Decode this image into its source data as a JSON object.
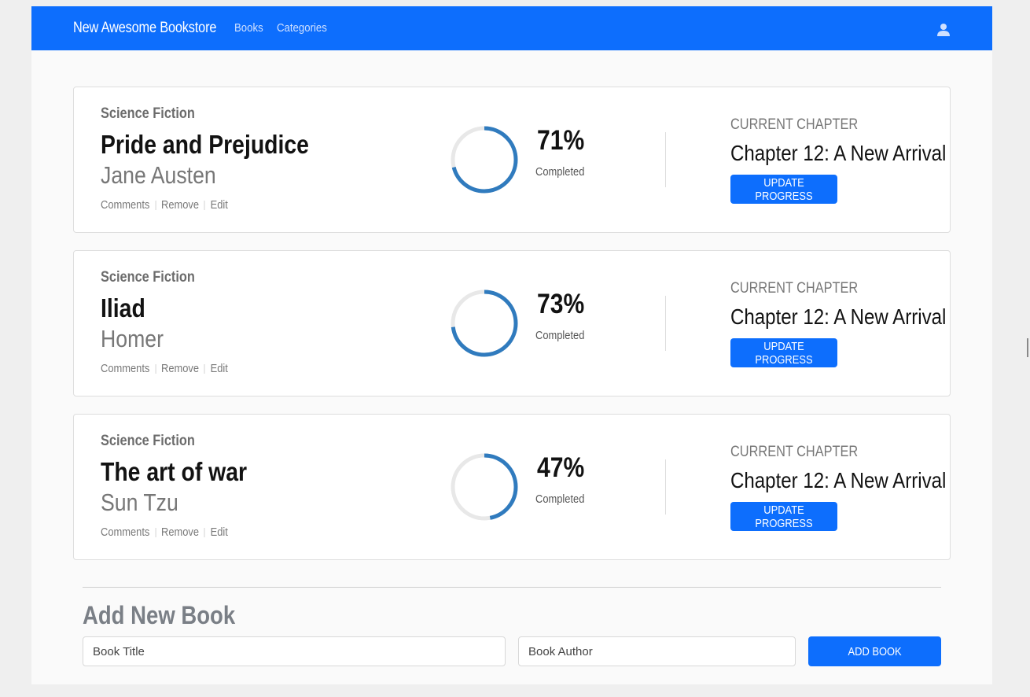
{
  "navbar": {
    "brand": "New Awesome Bookstore",
    "links": [
      {
        "label": "Books"
      },
      {
        "label": "Categories"
      }
    ],
    "user_icon": "user-icon"
  },
  "books": [
    {
      "genre": "Science Fiction",
      "title": "Pride and Prejudice",
      "author": "Jane Austen",
      "actions": [
        "Comments",
        "Remove",
        "Edit"
      ],
      "progress": 71,
      "progress_text": "71%",
      "completed_label": "Completed",
      "chapter_label": "CURRENT CHAPTER",
      "chapter": "Chapter 12: A New Arrival",
      "update_label": "UPDATE PROGRESS"
    },
    {
      "genre": "Science Fiction",
      "title": "Iliad",
      "author": "Homer",
      "actions": [
        "Comments",
        "Remove",
        "Edit"
      ],
      "progress": 73,
      "progress_text": "73%",
      "completed_label": "Completed",
      "chapter_label": "CURRENT CHAPTER",
      "chapter": "Chapter 12: A New Arrival",
      "update_label": "UPDATE PROGRESS"
    },
    {
      "genre": "Science Fiction",
      "title": "The art of war",
      "author": "Sun Tzu",
      "actions": [
        "Comments",
        "Remove",
        "Edit"
      ],
      "progress": 47,
      "progress_text": "47%",
      "completed_label": "Completed",
      "chapter_label": "CURRENT CHAPTER",
      "chapter": "Chapter 12: A New Arrival",
      "update_label": "UPDATE PROGRESS"
    }
  ],
  "add_form": {
    "heading": "Add New Book",
    "title_placeholder": "Book Title",
    "author_placeholder": "Book Author",
    "submit_label": "ADD BOOK"
  },
  "colors": {
    "primary": "#0d6efd",
    "progress": "#307bbe",
    "progress_track": "#e8e8e8"
  }
}
